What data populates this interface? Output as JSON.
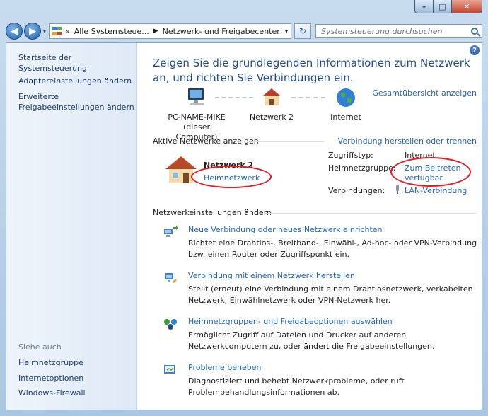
{
  "window": {
    "min_glyph": "–",
    "max_glyph": "□",
    "close_glyph": "✕"
  },
  "nav": {
    "back_glyph": "◀",
    "forward_glyph": "▶",
    "drop_glyph": "▾"
  },
  "address": {
    "prefix_glyph": "«",
    "crumbs": [
      "Alle Systemsteue...",
      "Netzwerk- und Freigabecenter"
    ],
    "sep_glyph": "▶",
    "drop_glyph": "▾",
    "refresh_glyph": "↻"
  },
  "search": {
    "placeholder": "Systemsteuerung durchsuchen"
  },
  "sidebar": {
    "links": [
      "Startseite der Systemsteuerung",
      "Adaptereinstellungen ändern",
      "Erweiterte Freigabeeinstellungen ändern"
    ],
    "see_also_label": "Siehe auch",
    "see_also": [
      "Heimnetzgruppe",
      "Internetoptionen",
      "Windows-Firewall"
    ]
  },
  "main": {
    "help_glyph": "?",
    "title": "Zeigen Sie die grundlegenden Informationen zum Netzwerk an, und richten Sie Verbindungen ein.",
    "overview_link": "Gesamtübersicht anzeigen",
    "map": {
      "computer": "PC-NAME-MIKE",
      "computer_sub": "(dieser Computer)",
      "network": "Netzwerk 2",
      "internet": "Internet"
    },
    "active": {
      "header": "Aktive Netzwerke anzeigen",
      "connect_link": "Verbindung herstellen oder trennen",
      "name": "Netzwerk 2",
      "type_link": "Heimnetzwerk",
      "access_label": "Zugriffstyp:",
      "access_value": "Internet",
      "homegroup_label": "Heimnetzgruppe:",
      "homegroup_value": "Zum Beitreten verfügbar",
      "connections_label": "Verbindungen:",
      "connections_value": "LAN-Verbindung"
    },
    "settings": {
      "header": "Netzwerkeinstellungen ändern",
      "tasks": [
        {
          "title": "Neue Verbindung oder neues Netzwerk einrichten",
          "desc": "Richtet eine Drahtlos-, Breitband-, Einwähl-, Ad-hoc- oder VPN-Verbindung bzw. einen Router oder Zugriffspunkt ein."
        },
        {
          "title": "Verbindung mit einem Netzwerk herstellen",
          "desc": "Stellt (erneut) eine Verbindung mit einem Drahtlosnetzwerk, verkabelten Netzwerk, Einwählnetzwerk oder VPN-Netzwerk her."
        },
        {
          "title": "Heimnetzgruppen- und Freigabeoptionen auswählen",
          "desc": "Ermöglicht Zugriff auf Dateien und Drucker auf anderen Netzwerkcomputern zu, oder ändert die Freigabeeinstellungen."
        },
        {
          "title": "Probleme beheben",
          "desc": "Diagnostiziert und behebt Netzwerkprobleme, oder ruft Problembehandlungsinformationen ab."
        }
      ]
    }
  }
}
